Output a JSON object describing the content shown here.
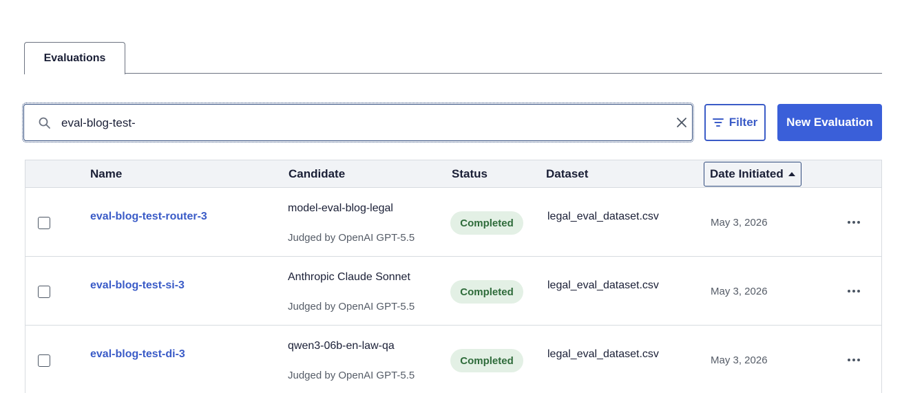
{
  "tabs": [
    {
      "label": "Evaluations"
    }
  ],
  "search": {
    "value": "eval-blog-test-",
    "placeholder": ""
  },
  "toolbar": {
    "filter_label": "Filter",
    "new_label": "New Evaluation"
  },
  "table": {
    "columns": [
      "Name",
      "Candidate",
      "Status",
      "Dataset",
      "Date Initiated"
    ],
    "rows": [
      {
        "name": "eval-blog-test-router-3",
        "candidate": "model-eval-blog-legal",
        "judge": "Judged by OpenAI GPT-5.5",
        "status": "Completed",
        "dataset": "legal_eval_dataset.csv",
        "date": "May 3, 2026"
      },
      {
        "name": "eval-blog-test-si-3",
        "candidate": "Anthropic Claude Sonnet",
        "judge": "Judged by OpenAI GPT-5.5",
        "status": "Completed",
        "dataset": "legal_eval_dataset.csv",
        "date": "May 3, 2026"
      },
      {
        "name": "eval-blog-test-di-3",
        "candidate": "qwen3-06b-en-law-qa",
        "judge": "Judged by OpenAI GPT-5.5",
        "status": "Completed",
        "dataset": "legal_eval_dataset.csv",
        "date": "May 3, 2026"
      }
    ]
  },
  "icons": {
    "search": "search-icon",
    "clear": "close-icon",
    "filter": "filter-icon",
    "sort": "sort-ascending-icon",
    "more": "more-horizontal-icon"
  },
  "colors": {
    "accent": "#3a5fd9",
    "link": "#3a5bc7",
    "status_completed_bg": "#e3f0e5",
    "status_completed_text": "#2e6b3a"
  }
}
